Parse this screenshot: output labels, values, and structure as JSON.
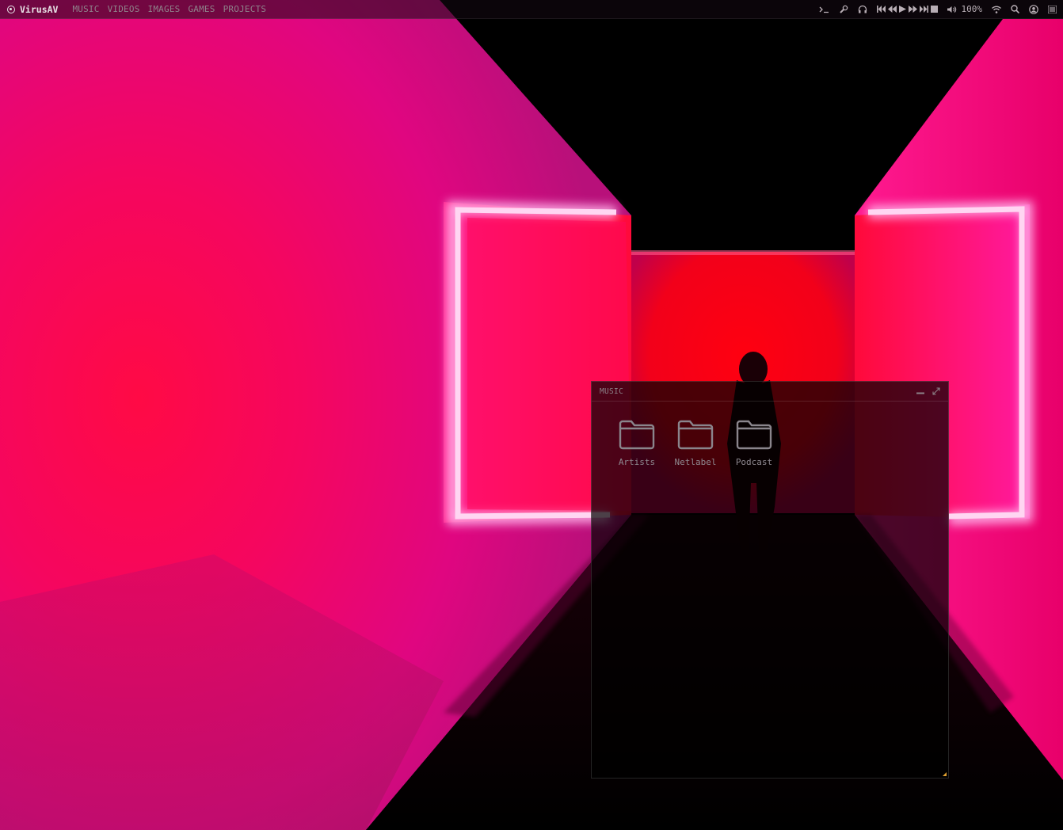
{
  "topbar": {
    "brand": "VirusAV",
    "menu": [
      "MUSIC",
      "VIDEOS",
      "IMAGES",
      "GAMES",
      "PROJECTS"
    ],
    "tray": {
      "terminal_icon": "terminal-icon",
      "steam_icon": "steam-icon",
      "headphones_icon": "headphones-icon",
      "media_icons": [
        "skip-back-icon",
        "rewind-icon",
        "play-icon",
        "fast-forward-icon",
        "skip-forward-icon",
        "stop-icon"
      ],
      "volume_icon": "volume-icon",
      "volume_pct": "100%",
      "wifi_icon": "wifi-icon",
      "search_icon": "search-icon",
      "user_icon": "user-icon",
      "menu_icon": "hamburger-icon"
    }
  },
  "window": {
    "title": "MUSIC",
    "controls": [
      "minimize-icon",
      "maximize-icon"
    ],
    "items": [
      {
        "label": "Artists",
        "icon": "folder-icon"
      },
      {
        "label": "Netlabel",
        "icon": "folder-icon"
      },
      {
        "label": "Podcast",
        "icon": "folder-icon"
      }
    ]
  },
  "colors": {
    "accent": "#e0a030",
    "wall_pink": "#ff1a78",
    "wall_red": "#ff0a2a",
    "neon": "#ff9ad8"
  }
}
